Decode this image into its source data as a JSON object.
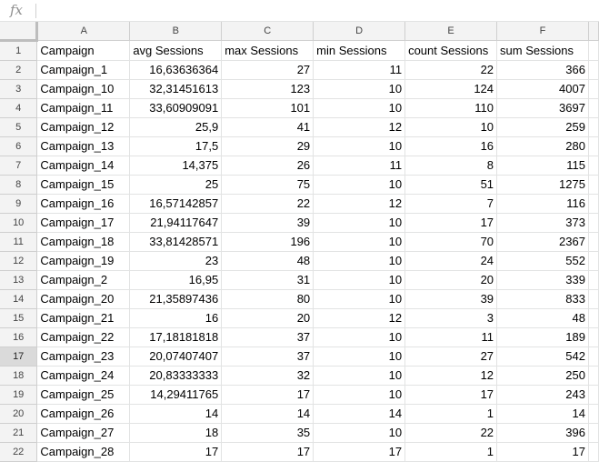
{
  "formula_bar": {
    "fx_label": "fx",
    "value": ""
  },
  "columns": [
    "A",
    "B",
    "C",
    "D",
    "E",
    "F"
  ],
  "active_row": "17",
  "rows": [
    {
      "n": "1",
      "cells": [
        "Campaign",
        "avg Sessions",
        "max Sessions",
        "min Sessions",
        "count Sessions",
        "sum Sessions"
      ]
    },
    {
      "n": "2",
      "cells": [
        "Campaign_1",
        "16,63636364",
        "27",
        "11",
        "22",
        "366"
      ]
    },
    {
      "n": "3",
      "cells": [
        "Campaign_10",
        "32,31451613",
        "123",
        "10",
        "124",
        "4007"
      ]
    },
    {
      "n": "4",
      "cells": [
        "Campaign_11",
        "33,60909091",
        "101",
        "10",
        "110",
        "3697"
      ]
    },
    {
      "n": "5",
      "cells": [
        "Campaign_12",
        "25,9",
        "41",
        "12",
        "10",
        "259"
      ]
    },
    {
      "n": "6",
      "cells": [
        "Campaign_13",
        "17,5",
        "29",
        "10",
        "16",
        "280"
      ]
    },
    {
      "n": "7",
      "cells": [
        "Campaign_14",
        "14,375",
        "26",
        "11",
        "8",
        "115"
      ]
    },
    {
      "n": "8",
      "cells": [
        "Campaign_15",
        "25",
        "75",
        "10",
        "51",
        "1275"
      ]
    },
    {
      "n": "9",
      "cells": [
        "Campaign_16",
        "16,57142857",
        "22",
        "12",
        "7",
        "116"
      ]
    },
    {
      "n": "10",
      "cells": [
        "Campaign_17",
        "21,94117647",
        "39",
        "10",
        "17",
        "373"
      ]
    },
    {
      "n": "11",
      "cells": [
        "Campaign_18",
        "33,81428571",
        "196",
        "10",
        "70",
        "2367"
      ]
    },
    {
      "n": "12",
      "cells": [
        "Campaign_19",
        "23",
        "48",
        "10",
        "24",
        "552"
      ]
    },
    {
      "n": "13",
      "cells": [
        "Campaign_2",
        "16,95",
        "31",
        "10",
        "20",
        "339"
      ]
    },
    {
      "n": "14",
      "cells": [
        "Campaign_20",
        "21,35897436",
        "80",
        "10",
        "39",
        "833"
      ]
    },
    {
      "n": "15",
      "cells": [
        "Campaign_21",
        "16",
        "20",
        "12",
        "3",
        "48"
      ]
    },
    {
      "n": "16",
      "cells": [
        "Campaign_22",
        "17,18181818",
        "37",
        "10",
        "11",
        "189"
      ]
    },
    {
      "n": "17",
      "cells": [
        "Campaign_23",
        "20,07407407",
        "37",
        "10",
        "27",
        "542"
      ]
    },
    {
      "n": "18",
      "cells": [
        "Campaign_24",
        "20,83333333",
        "32",
        "10",
        "12",
        "250"
      ]
    },
    {
      "n": "19",
      "cells": [
        "Campaign_25",
        "14,29411765",
        "17",
        "10",
        "17",
        "243"
      ]
    },
    {
      "n": "20",
      "cells": [
        "Campaign_26",
        "14",
        "14",
        "14",
        "1",
        "14"
      ]
    },
    {
      "n": "21",
      "cells": [
        "Campaign_27",
        "18",
        "35",
        "10",
        "22",
        "396"
      ]
    },
    {
      "n": "22",
      "cells": [
        "Campaign_28",
        "17",
        "17",
        "17",
        "1",
        "17"
      ]
    }
  ]
}
